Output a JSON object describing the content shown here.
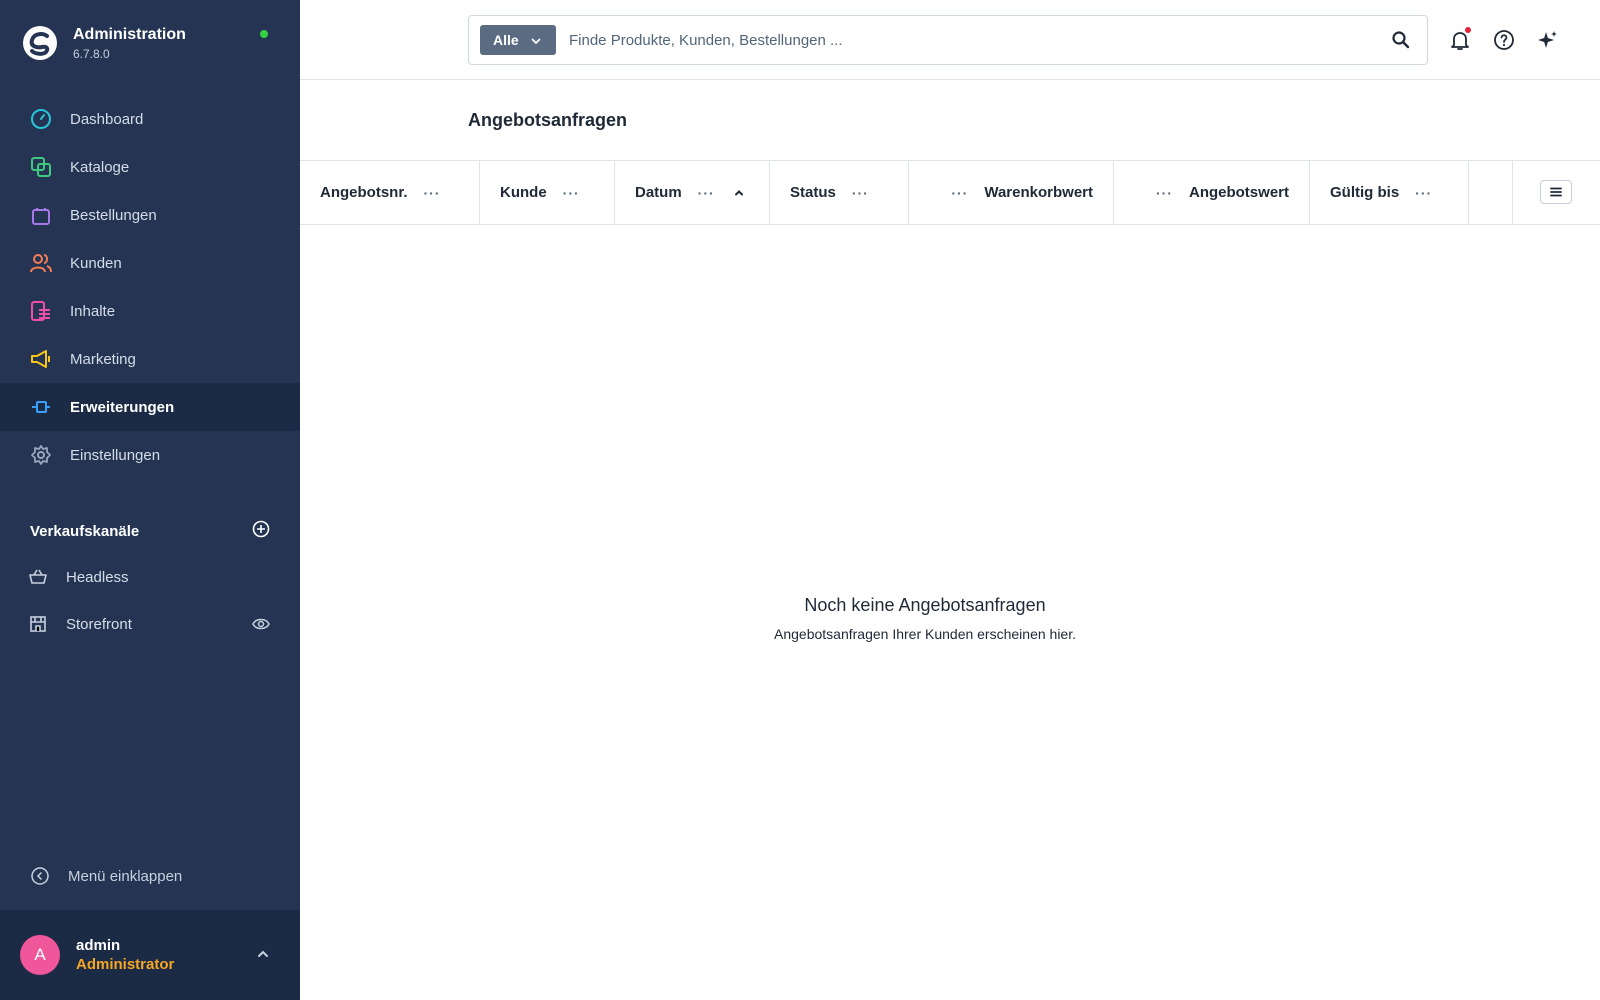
{
  "app": {
    "title": "Administration",
    "version": "6.7.8.0"
  },
  "colors": {
    "sidebar": "#243452",
    "sidebar_active": "#1b2a45",
    "accent_green": "#37d046",
    "role": "#f5a623",
    "avatar": "#f0569a"
  },
  "sidebar": {
    "items": [
      {
        "label": "Dashboard",
        "icon": "gauge-icon",
        "color": "#26c6da"
      },
      {
        "label": "Kataloge",
        "icon": "catalog-icon",
        "color": "#3fc87f"
      },
      {
        "label": "Bestellungen",
        "icon": "shopping-bag-icon",
        "color": "#a678e8"
      },
      {
        "label": "Kunden",
        "icon": "users-icon",
        "color": "#f27d52"
      },
      {
        "label": "Inhalte",
        "icon": "content-icon",
        "color": "#ee4fa9"
      },
      {
        "label": "Marketing",
        "icon": "megaphone-icon",
        "color": "#f5c518"
      },
      {
        "label": "Erweiterungen",
        "icon": "plug-icon",
        "color": "#3aa0ff",
        "active": true
      },
      {
        "label": "Einstellungen",
        "icon": "gear-icon",
        "color": "#9aa8bd"
      }
    ],
    "section_title": "Verkaufskanäle",
    "channels": [
      {
        "label": "Headless",
        "icon": "basket-icon"
      },
      {
        "label": "Storefront",
        "icon": "storefront-icon"
      }
    ],
    "collapse_label": "Menü einklappen"
  },
  "user": {
    "initial": "A",
    "name": "admin",
    "role": "Administrator"
  },
  "search": {
    "scope": "Alle",
    "placeholder": "Finde Produkte, Kunden, Bestellungen ..."
  },
  "page": {
    "title": "Angebotsanfragen"
  },
  "grid": {
    "columns": [
      {
        "label": "Angebotsnr."
      },
      {
        "label": "Kunde"
      },
      {
        "label": "Datum",
        "sorted": "asc"
      },
      {
        "label": "Status"
      },
      {
        "label": "Warenkorbwert"
      },
      {
        "label": "Angebotswert"
      },
      {
        "label": "Gültig bis"
      }
    ],
    "dots": "···"
  },
  "empty_state": {
    "title": "Noch keine Angebotsanfragen",
    "subtitle": "Angebotsanfragen Ihrer Kunden erscheinen hier."
  }
}
